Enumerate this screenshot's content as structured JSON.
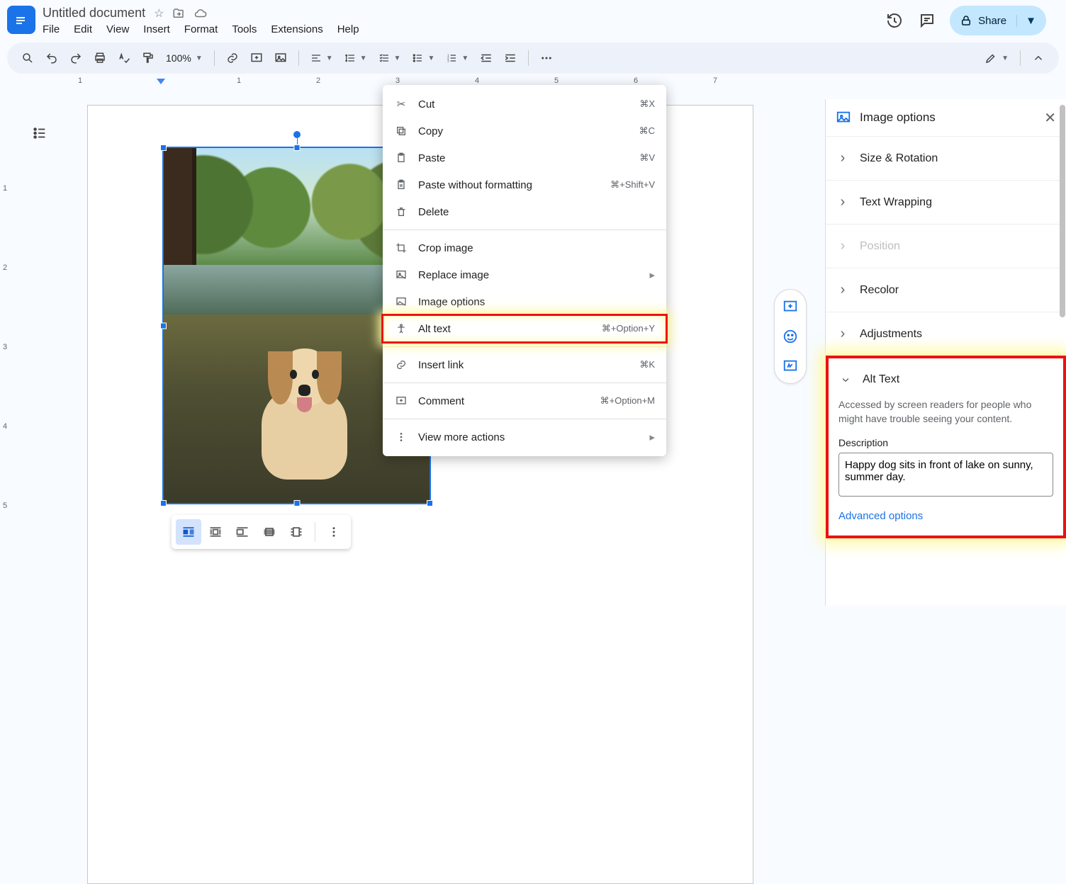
{
  "doc": {
    "title": "Untitled document"
  },
  "menus": {
    "file": "File",
    "edit": "Edit",
    "view": "View",
    "insert": "Insert",
    "format": "Format",
    "tools": "Tools",
    "extensions": "Extensions",
    "help": "Help"
  },
  "actions": {
    "share": "Share"
  },
  "toolbar": {
    "zoom": "100%"
  },
  "ruler": [
    "1",
    "1",
    "2",
    "3",
    "4",
    "5",
    "6",
    "7"
  ],
  "ctx": {
    "cut": {
      "label": "Cut",
      "shortcut": "⌘X"
    },
    "copy": {
      "label": "Copy",
      "shortcut": "⌘C"
    },
    "paste": {
      "label": "Paste",
      "shortcut": "⌘V"
    },
    "paste_nf": {
      "label": "Paste without formatting",
      "shortcut": "⌘+Shift+V"
    },
    "delete": {
      "label": "Delete"
    },
    "crop": {
      "label": "Crop image"
    },
    "replace": {
      "label": "Replace image"
    },
    "imgopts": {
      "label": "Image options"
    },
    "alt": {
      "label": "Alt text",
      "shortcut": "⌘+Option+Y"
    },
    "link": {
      "label": "Insert link",
      "shortcut": "⌘K"
    },
    "comment": {
      "label": "Comment",
      "shortcut": "⌘+Option+M"
    },
    "more": {
      "label": "View more actions"
    }
  },
  "panel": {
    "title": "Image options",
    "sections": {
      "size": "Size & Rotation",
      "wrap": "Text Wrapping",
      "position": "Position",
      "recolor": "Recolor",
      "adjust": "Adjustments",
      "alt": "Alt Text"
    },
    "alt": {
      "help": "Accessed by screen readers for people who might have trouble seeing your content.",
      "desc_label": "Description",
      "desc_value": "Happy dog sits in front of lake on sunny, summer day.",
      "advanced": "Advanced options"
    }
  }
}
